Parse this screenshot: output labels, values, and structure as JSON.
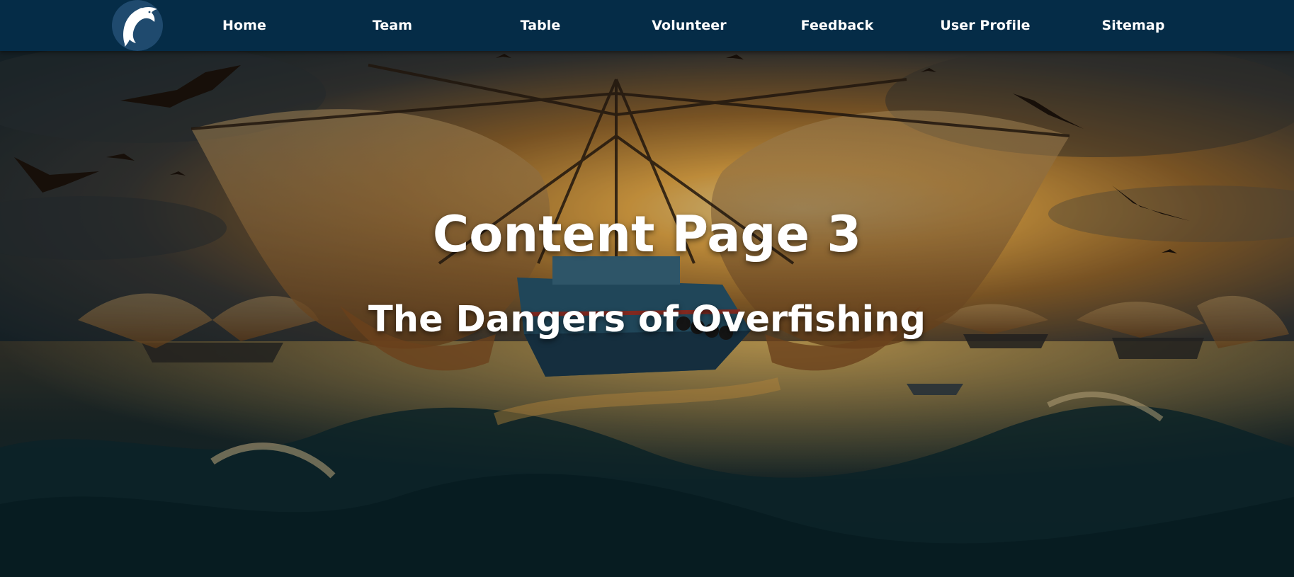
{
  "nav": {
    "logo_icon": "dolphin-icon",
    "items": [
      {
        "label": "Home"
      },
      {
        "label": "Team"
      },
      {
        "label": "Table"
      },
      {
        "label": "Volunteer"
      },
      {
        "label": "Feedback"
      },
      {
        "label": "User Profile"
      },
      {
        "label": "Sitemap"
      }
    ]
  },
  "hero": {
    "title": "Content Page 3",
    "subtitle": "The Dangers of Overfishing",
    "image_subject": "fishing-trawler-with-nets-at-sunset"
  },
  "colors": {
    "nav_background": "#052c47",
    "logo_background": "#1f4a6e",
    "text": "#ffffff",
    "sky_glow": "#f2b24a",
    "sea_dark": "#0e2a32"
  }
}
